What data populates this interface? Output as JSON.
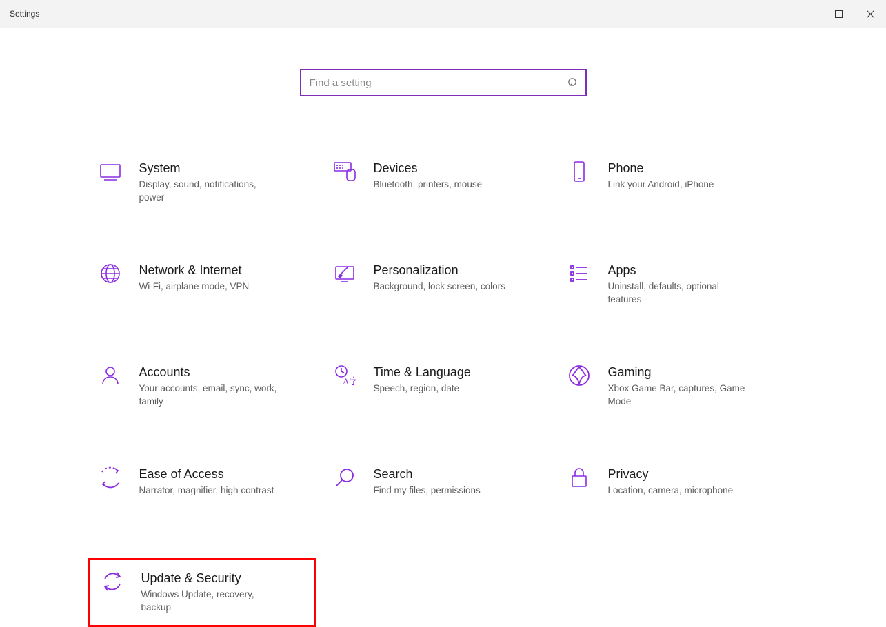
{
  "window": {
    "title": "Settings"
  },
  "search": {
    "placeholder": "Find a setting"
  },
  "categories": [
    {
      "id": "system",
      "title": "System",
      "desc": "Display, sound, notifications, power"
    },
    {
      "id": "devices",
      "title": "Devices",
      "desc": "Bluetooth, printers, mouse"
    },
    {
      "id": "phone",
      "title": "Phone",
      "desc": "Link your Android, iPhone"
    },
    {
      "id": "network",
      "title": "Network & Internet",
      "desc": "Wi-Fi, airplane mode, VPN"
    },
    {
      "id": "personalization",
      "title": "Personalization",
      "desc": "Background, lock screen, colors"
    },
    {
      "id": "apps",
      "title": "Apps",
      "desc": "Uninstall, defaults, optional features"
    },
    {
      "id": "accounts",
      "title": "Accounts",
      "desc": "Your accounts, email, sync, work, family"
    },
    {
      "id": "time",
      "title": "Time & Language",
      "desc": "Speech, region, date"
    },
    {
      "id": "gaming",
      "title": "Gaming",
      "desc": "Xbox Game Bar, captures, Game Mode"
    },
    {
      "id": "ease",
      "title": "Ease of Access",
      "desc": "Narrator, magnifier, high contrast"
    },
    {
      "id": "search",
      "title": "Search",
      "desc": "Find my files, permissions"
    },
    {
      "id": "privacy",
      "title": "Privacy",
      "desc": "Location, camera, microphone"
    },
    {
      "id": "update",
      "title": "Update & Security",
      "desc": "Windows Update, recovery, backup"
    }
  ],
  "highlighted_category": "update",
  "colors": {
    "accent": "#8a2be2",
    "highlight": "#ff0000"
  }
}
